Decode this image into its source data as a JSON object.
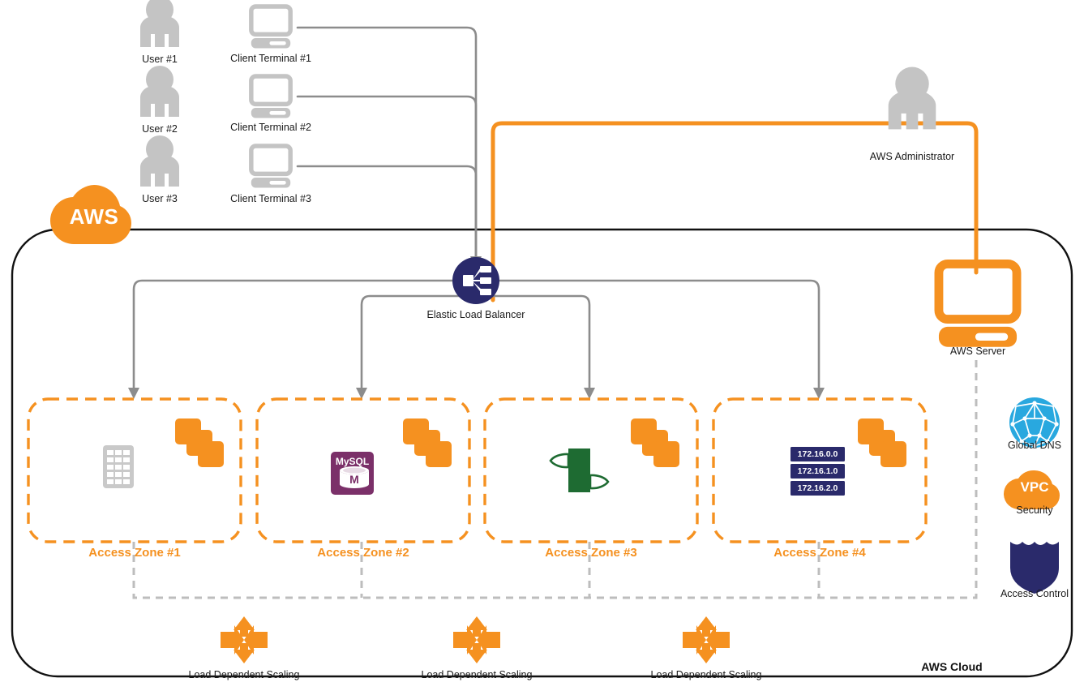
{
  "diagram": {
    "title": "AWS Cloud",
    "cloud_label": "AWS Cloud",
    "aws_badge": "AWS"
  },
  "colors": {
    "aws_orange": "#f59120",
    "gray_icon": "#c4c4c4",
    "gray_line": "#8c8c8c",
    "navy": "#2a2a6b",
    "mysql_purple": "#7b3069",
    "beanstalk_green": "#1e6b32",
    "dns_blue": "#29a8df",
    "border_black": "#111111",
    "dashed_gray": "#bdbdbd"
  },
  "users": [
    {
      "label": "User #1"
    },
    {
      "label": "User #2"
    },
    {
      "label": "User #3"
    }
  ],
  "terminals": [
    {
      "label": "Client Terminal #1"
    },
    {
      "label": "Client Terminal #2"
    },
    {
      "label": "Client Terminal #3"
    }
  ],
  "admin": {
    "label": "AWS Administrator",
    "icon": "person-icon"
  },
  "server": {
    "label": "AWS Server",
    "icon": "desktop-computer-icon"
  },
  "load_balancer": {
    "label": "Elastic Load Balancer",
    "icon": "elastic-load-balancer-icon"
  },
  "zones": [
    {
      "label": "Access Zone #1",
      "icon": "storage-grid-icon",
      "instances_icon": "ec2-instances-stack-icon"
    },
    {
      "label": "Access Zone #2",
      "icon": "mysql-database-icon",
      "icon_text": "MySQL",
      "icon_badge": "M",
      "instances_icon": "ec2-instances-stack-icon"
    },
    {
      "label": "Access Zone #3",
      "icon": "elastic-beanstalk-icon",
      "instances_icon": "ec2-instances-stack-icon"
    },
    {
      "label": "Access Zone #4",
      "icon": "ip-address-list-icon",
      "ip_addresses": [
        "172.16.0.0",
        "172.16.1.0",
        "172.16.2.0"
      ],
      "instances_icon": "ec2-instances-stack-icon"
    }
  ],
  "scaling": [
    {
      "label": "Load Dependent Scaling",
      "icon": "four-way-scaling-arrows-icon"
    },
    {
      "label": "Load Dependent Scaling",
      "icon": "four-way-scaling-arrows-icon"
    },
    {
      "label": "Load Dependent Scaling",
      "icon": "four-way-scaling-arrows-icon"
    }
  ],
  "services": [
    {
      "label": "Global DNS",
      "icon": "global-dns-globe-icon"
    },
    {
      "label": "Security",
      "icon": "vpc-cloud-icon",
      "icon_text": "VPC"
    },
    {
      "label": "Access Control",
      "icon": "shield-icon"
    }
  ]
}
